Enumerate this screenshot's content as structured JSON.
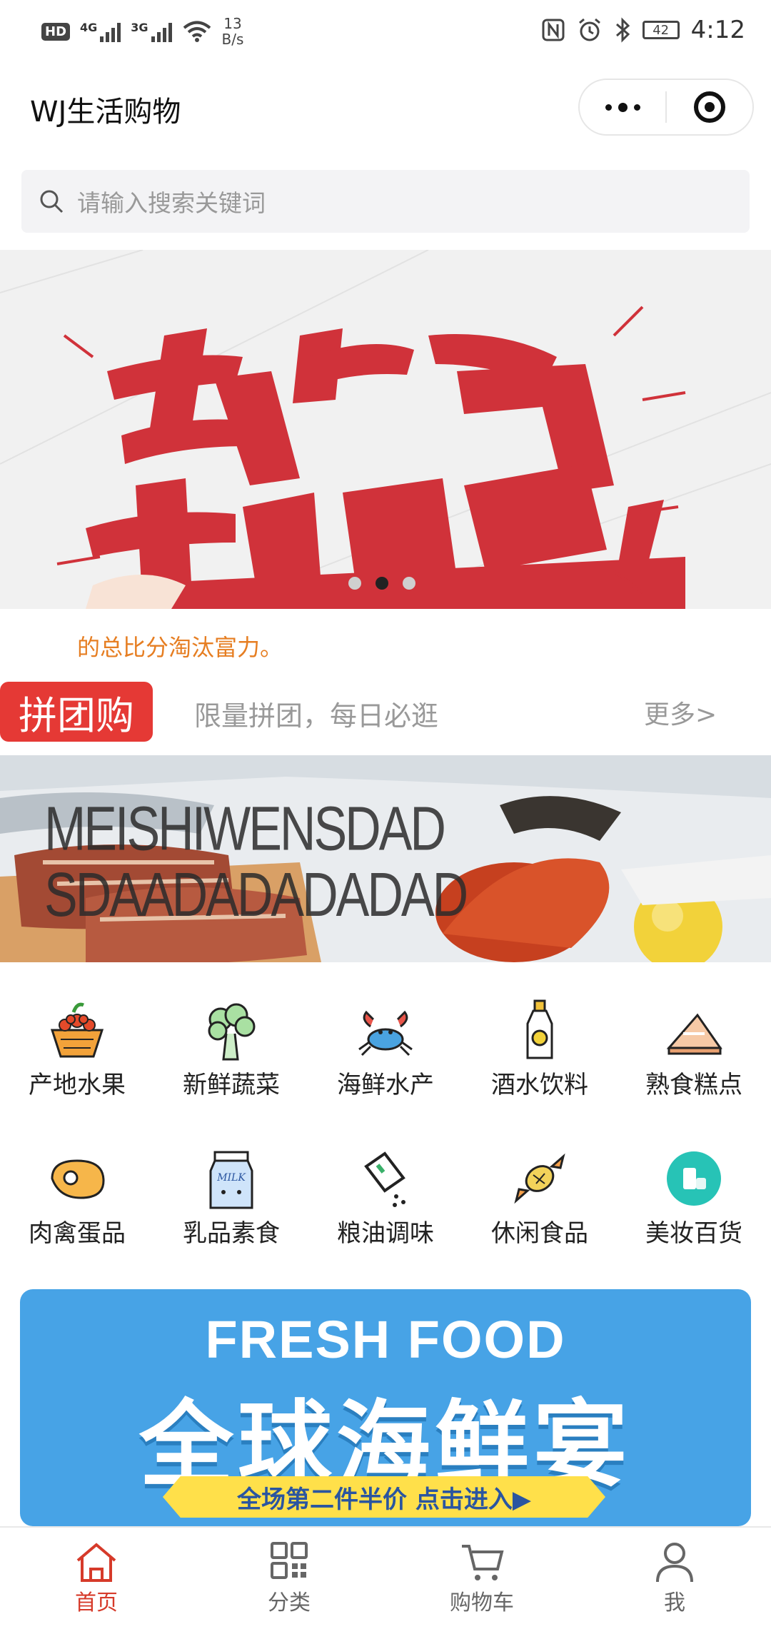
{
  "status_bar": {
    "hd": "HD",
    "net1": "4G",
    "net2": "3G",
    "speed_value": "13",
    "speed_unit": "B/s",
    "battery": "42",
    "time": "4:12"
  },
  "header": {
    "title": "WJ生活购物"
  },
  "search": {
    "placeholder": "请输入搜索关键词"
  },
  "banner": {
    "active_index": 1,
    "count": 3
  },
  "notice": {
    "text": "的总比分淘汰富力。"
  },
  "group_buy": {
    "badge": "拼团购",
    "subtitle": "限量拼团，每日必逛",
    "more": "更多>"
  },
  "food_banner": {
    "line1": "MEISHIWENSDAD",
    "line2": "SDAADADADADAD"
  },
  "categories": [
    {
      "label": "产地水果",
      "icon": "fruit-basket-icon"
    },
    {
      "label": "新鲜蔬菜",
      "icon": "broccoli-icon"
    },
    {
      "label": "海鲜水产",
      "icon": "crab-icon"
    },
    {
      "label": "酒水饮料",
      "icon": "bottle-icon"
    },
    {
      "label": "熟食糕点",
      "icon": "cake-icon"
    },
    {
      "label": "肉禽蛋品",
      "icon": "meat-icon"
    },
    {
      "label": "乳品素食",
      "icon": "milk-icon"
    },
    {
      "label": "粮油调味",
      "icon": "seasoning-icon"
    },
    {
      "label": "休闲食品",
      "icon": "candy-icon"
    },
    {
      "label": "美妆百货",
      "icon": "cosmetics-icon"
    }
  ],
  "promo": {
    "en": "FRESH FOOD",
    "cn": "全球海鲜宴",
    "ribbon": "全场第二件半价  点击进入▶"
  },
  "tabbar": [
    {
      "label": "首页",
      "icon": "home-icon",
      "active": true
    },
    {
      "label": "分类",
      "icon": "category-icon",
      "active": false
    },
    {
      "label": "购物车",
      "icon": "cart-icon",
      "active": false
    },
    {
      "label": "我",
      "icon": "user-icon",
      "active": false
    }
  ],
  "colors": {
    "accent": "#d63a2a",
    "group_red": "#e53935",
    "notice_orange": "#e67e22",
    "promo_blue": "#47a3e6"
  }
}
